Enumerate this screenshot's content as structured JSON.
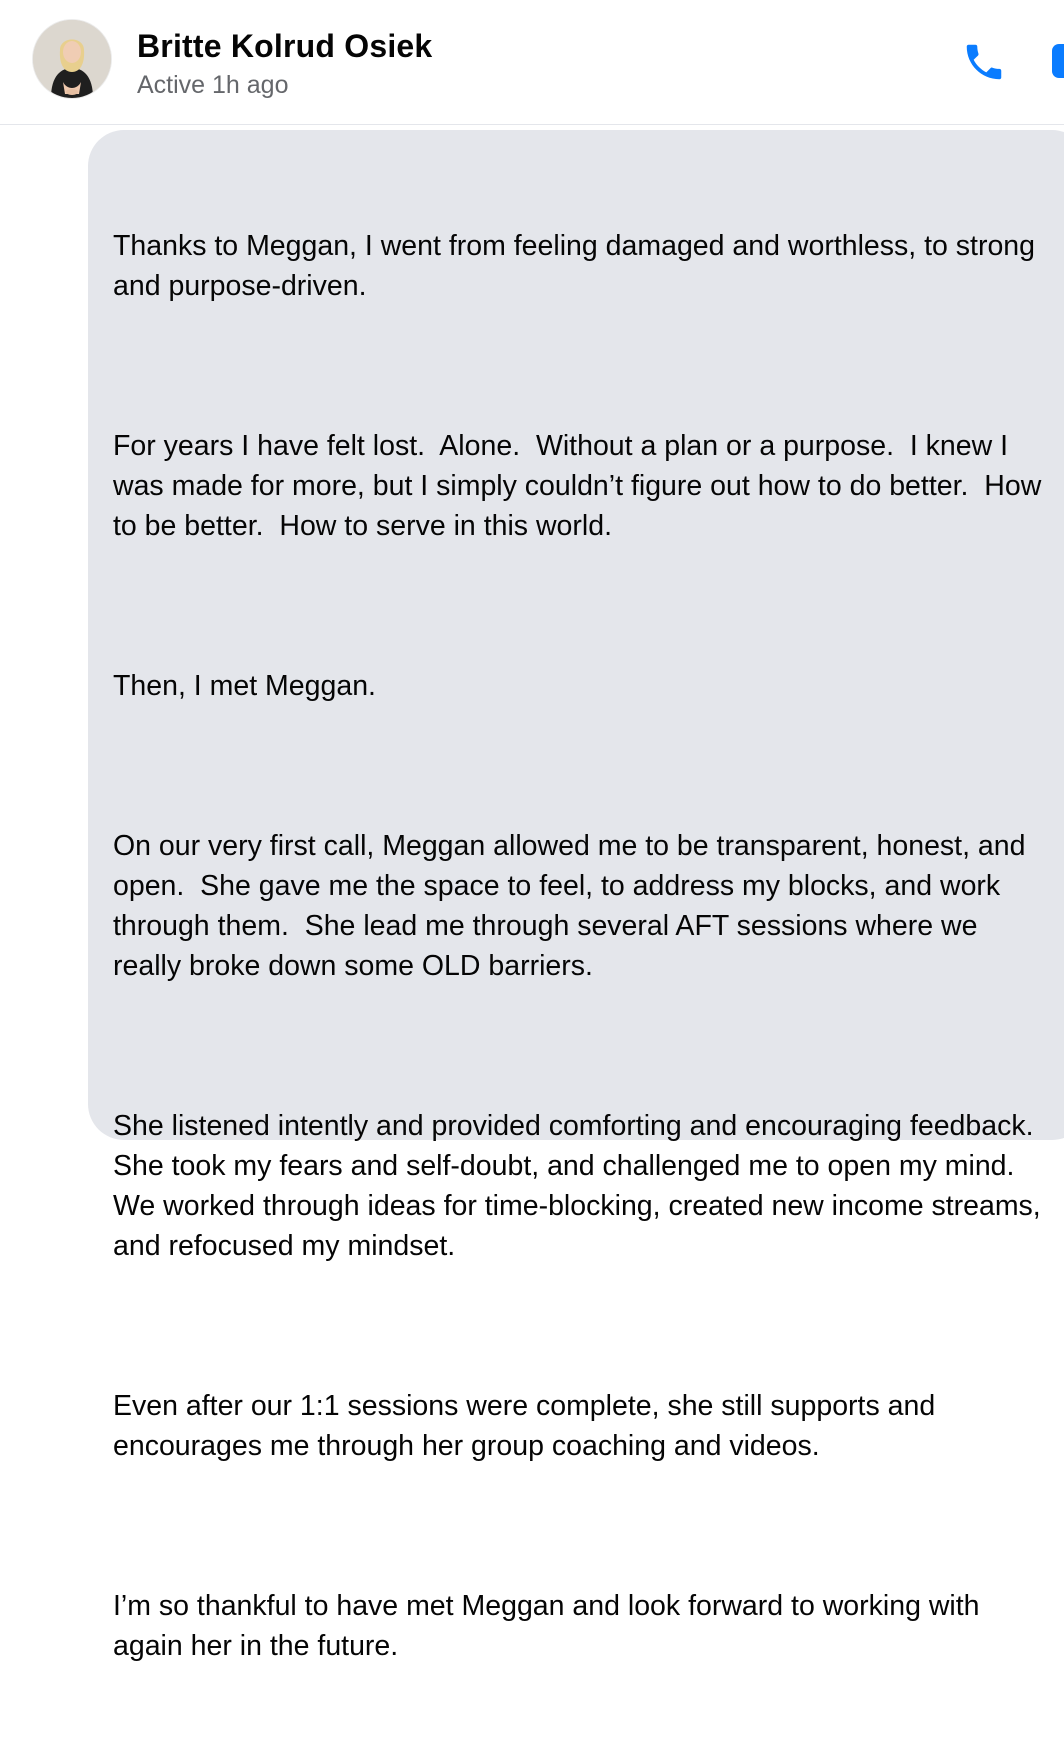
{
  "header": {
    "contact_name": "Britte Kolrud Osiek",
    "status": "Active 1h ago",
    "avatar_icon": "profile-photo",
    "call_icon": "phone-icon",
    "video_icon": "video-camera-icon",
    "accent_color": "#0a7cff"
  },
  "message": {
    "bubble_color": "#e4e6eb",
    "paragraphs": [
      "Thanks to Meggan, I went from feeling damaged and worthless, to strong and purpose-driven.",
      "For years I have felt lost.  Alone.  Without a plan or a purpose.  I knew I was made for more, but I simply couldn’t figure out how to do better.  How to be better.  How to serve in this world.",
      "Then, I met Meggan.",
      "On our very first call, Meggan allowed me to be transparent, honest, and open.  She gave me the space to feel, to address my blocks, and work through them.  She lead me through several AFT sessions where we really broke down some OLD barriers.",
      "She listened intently and provided comforting and encouraging feedback.  She took my fears and self-doubt, and challenged me to open my mind.  We worked through ideas for time-blocking, created new income streams, and refocused my mindset.",
      "Even after our 1:1 sessions were complete, she still supports and encourages me through her group coaching and videos.",
      "I’m so thankful to have met Meggan and look forward to working with again her in the future."
    ]
  }
}
